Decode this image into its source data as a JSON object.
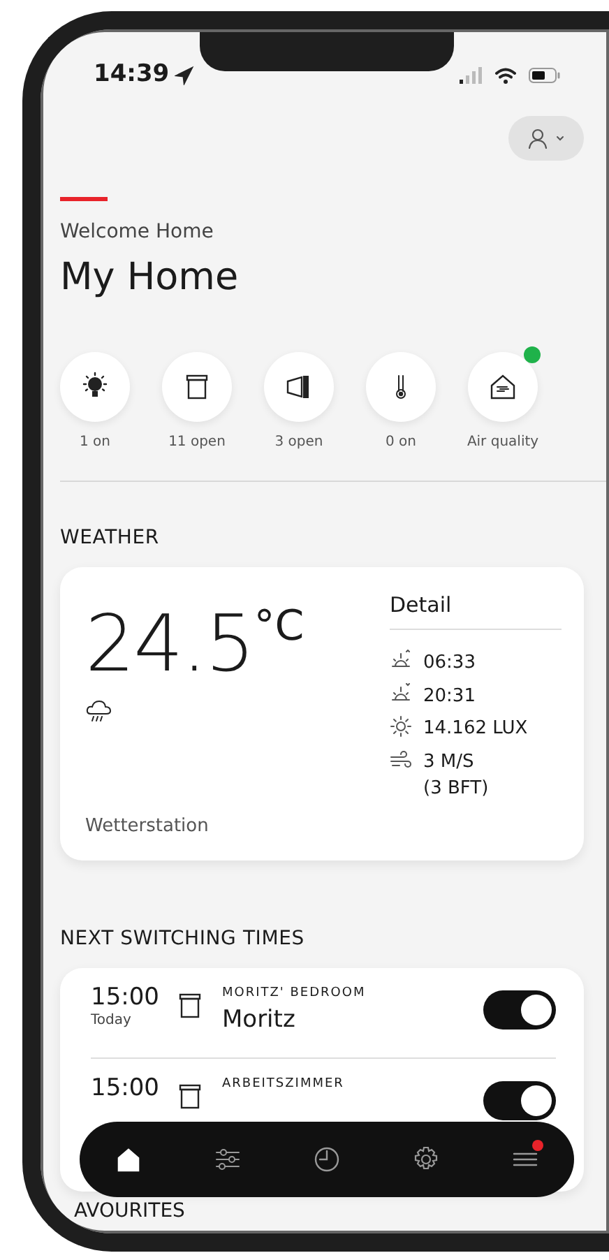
{
  "status_bar": {
    "time": "14:39"
  },
  "header": {
    "subtitle": "Welcome Home",
    "title": "My Home"
  },
  "tiles": [
    {
      "kind": "light",
      "label": "1 on",
      "alert": false
    },
    {
      "kind": "blind",
      "label": "11 open",
      "alert": false
    },
    {
      "kind": "window",
      "label": "3 open",
      "alert": false
    },
    {
      "kind": "thermometer",
      "label": "0 on",
      "alert": false
    },
    {
      "kind": "air",
      "label": "Air quality",
      "alert": true
    }
  ],
  "weather": {
    "heading": "WEATHER",
    "temperature": "24.5",
    "unit": "°C",
    "station": "Wetterstation",
    "detail_title": "Detail",
    "details": [
      {
        "kind": "sunrise",
        "text": "06:33"
      },
      {
        "kind": "sunset",
        "text": "20:31"
      },
      {
        "kind": "brightness",
        "text": "14.162 LUX"
      },
      {
        "kind": "wind",
        "text": "3 M/S",
        "text2": "(3 BFT)"
      }
    ]
  },
  "schedules_heading": "NEXT SWITCHING TIMES",
  "schedules": [
    {
      "time": "15:00",
      "day": "Today",
      "room": "MORITZ' BEDROOM",
      "name": "Moritz",
      "on": true
    },
    {
      "time": "15:00",
      "room": "ARBEITSZIMMER",
      "on": true
    }
  ],
  "favourites_heading": "AVOURITES",
  "nav": [
    {
      "kind": "home",
      "selected": true,
      "badge": false
    },
    {
      "kind": "controls",
      "selected": false,
      "badge": false
    },
    {
      "kind": "clock",
      "selected": false,
      "badge": false
    },
    {
      "kind": "settings",
      "selected": false,
      "badge": false
    },
    {
      "kind": "menu",
      "selected": false,
      "badge": true
    }
  ]
}
